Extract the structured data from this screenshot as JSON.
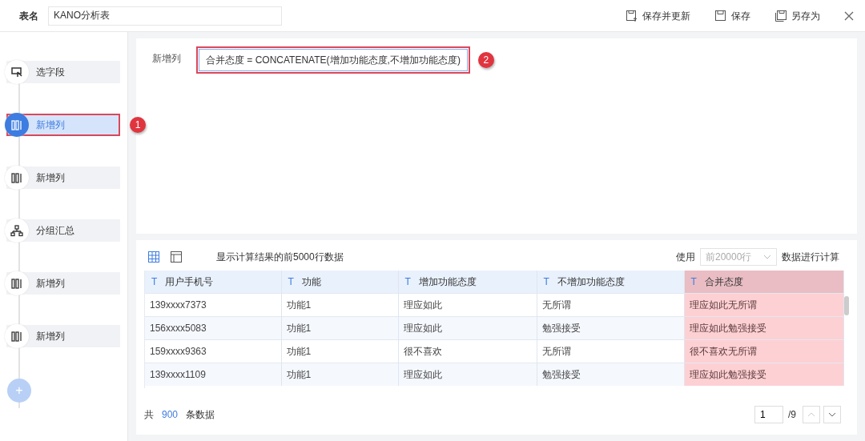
{
  "header": {
    "table_name_label": "表名",
    "table_name": "KANO分析表",
    "actions": [
      {
        "kind": "save-update",
        "label": "保存并更新"
      },
      {
        "kind": "save",
        "label": "保存"
      },
      {
        "kind": "save-as",
        "label": "另存为"
      }
    ]
  },
  "steps": [
    {
      "kind": "fields",
      "label": "选字段",
      "selected": false,
      "highlighted": false
    },
    {
      "kind": "column",
      "label": "新增列",
      "selected": true,
      "highlighted": true,
      "callout": "1"
    },
    {
      "kind": "column",
      "label": "新增列",
      "selected": false,
      "highlighted": false
    },
    {
      "kind": "group",
      "label": "分组汇总",
      "selected": false,
      "highlighted": false
    },
    {
      "kind": "column",
      "label": "新增列",
      "selected": false,
      "highlighted": false
    },
    {
      "kind": "column",
      "label": "新增列",
      "selected": false,
      "highlighted": false
    }
  ],
  "add_step": "+",
  "formula": {
    "label": "新增列",
    "value": "合并态度 = CONCATENATE(增加功能态度,不增加功能态度)",
    "highlighted": true,
    "callout": "2"
  },
  "preview": {
    "view_tabs": [
      {
        "kind": "grid",
        "selected": true
      },
      {
        "kind": "panel",
        "selected": false
      }
    ],
    "note": "显示计算结果的前5000行数据",
    "use_label": "使用",
    "rows_select": "前20000行",
    "calc_label": "数据进行计算",
    "columns": [
      {
        "label": "用户手机号",
        "type_icon": "T",
        "highlighted": false
      },
      {
        "label": "功能",
        "type_icon": "T",
        "highlighted": false
      },
      {
        "label": "增加功能态度",
        "type_icon": "T",
        "highlighted": false
      },
      {
        "label": "不增加功能态度",
        "type_icon": "T",
        "highlighted": false
      },
      {
        "label": "合并态度",
        "type_icon": "T",
        "highlighted": true
      }
    ],
    "rows": [
      [
        "139xxxx7373",
        "功能1",
        "理应如此",
        "无所谓",
        "理应如此无所谓"
      ],
      [
        "156xxxx5083",
        "功能1",
        "理应如此",
        "勉强接受",
        "理应如此勉强接受"
      ],
      [
        "159xxxx9363",
        "功能1",
        "很不喜欢",
        "无所谓",
        "很不喜欢无所谓"
      ],
      [
        "139xxxx1109",
        "功能1",
        "理应如此",
        "勉强接受",
        "理应如此勉强接受"
      ]
    ],
    "total_prefix": "共",
    "total": "900",
    "total_suffix": "条数据",
    "page": "1",
    "pages": "/9"
  }
}
